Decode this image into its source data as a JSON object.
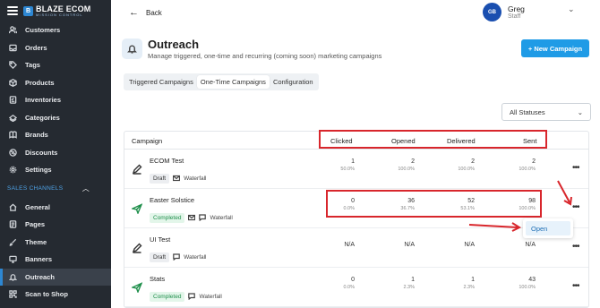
{
  "brand": {
    "name": "BLAZE ECOM",
    "tagline": "MISSION CONTROL"
  },
  "sidebar": {
    "items": [
      {
        "label": "Customers",
        "icon": "users-icon"
      },
      {
        "label": "Orders",
        "icon": "inbox-icon"
      },
      {
        "label": "Tags",
        "icon": "tag-icon"
      },
      {
        "label": "Products",
        "icon": "box-icon"
      },
      {
        "label": "Inventories",
        "icon": "list-check-icon"
      },
      {
        "label": "Categories",
        "icon": "categories-icon"
      },
      {
        "label": "Brands",
        "icon": "book-icon"
      },
      {
        "label": "Discounts",
        "icon": "discount-icon"
      },
      {
        "label": "Settings",
        "icon": "gear-icon"
      }
    ],
    "section_label": "SALES CHANNELS",
    "channel_items": [
      {
        "label": "General",
        "icon": "home-icon"
      },
      {
        "label": "Pages",
        "icon": "pages-icon"
      },
      {
        "label": "Theme",
        "icon": "brush-icon"
      },
      {
        "label": "Banners",
        "icon": "monitor-icon"
      },
      {
        "label": "Outreach",
        "icon": "bell-icon",
        "active": true
      },
      {
        "label": "Scan to Shop",
        "icon": "qr-icon"
      }
    ]
  },
  "header": {
    "back_label": "Back",
    "user": {
      "initials": "GB",
      "name": "Greg",
      "role": "Staff"
    }
  },
  "page": {
    "title": "Outreach",
    "subtitle": "Manage triggered, one-time and recurring (coming soon) marketing campaigns",
    "new_button": "+ New Campaign"
  },
  "tabs": [
    {
      "label": "Triggered Campaigns",
      "active": false
    },
    {
      "label": "One-Time Campaigns",
      "active": true
    },
    {
      "label": "Configuration",
      "active": false
    }
  ],
  "filter": {
    "selected": "All Statuses"
  },
  "table": {
    "headers": {
      "campaign": "Campaign",
      "clicked": "Clicked",
      "opened": "Opened",
      "delivered": "Delivered",
      "sent": "Sent"
    },
    "rows": [
      {
        "name": "ECOM Test",
        "status": "Draft",
        "status_type": "draft",
        "icon": "pencil-icon",
        "meta": "Waterfall",
        "clicked": {
          "v": "1",
          "p": "50.0%"
        },
        "opened": {
          "v": "2",
          "p": "100.0%"
        },
        "delivered": {
          "v": "2",
          "p": "100.0%"
        },
        "sent": {
          "v": "2",
          "p": "100.0%"
        }
      },
      {
        "name": "Easter Solstice",
        "status": "Completed",
        "status_type": "completed",
        "icon": "send-icon",
        "meta": "Waterfall",
        "clicked": {
          "v": "0",
          "p": "0.0%"
        },
        "opened": {
          "v": "36",
          "p": "36.7%"
        },
        "delivered": {
          "v": "52",
          "p": "53.1%"
        },
        "sent": {
          "v": "98",
          "p": "100.0%"
        }
      },
      {
        "name": "UI Test",
        "status": "Draft",
        "status_type": "draft",
        "icon": "pencil-icon",
        "meta": "Waterfall",
        "clicked": {
          "na": "N/A"
        },
        "opened": {
          "na": "N/A"
        },
        "delivered": {
          "na": "N/A"
        },
        "sent": {
          "na": "N/A"
        }
      },
      {
        "name": "Stats",
        "status": "Completed",
        "status_type": "completed",
        "icon": "send-icon",
        "meta": "Waterfall",
        "clicked": {
          "v": "0",
          "p": "0.0%"
        },
        "opened": {
          "v": "1",
          "p": "2.3%"
        },
        "delivered": {
          "v": "1",
          "p": "2.3%"
        },
        "sent": {
          "v": "43",
          "p": "100.0%"
        }
      }
    ]
  },
  "row_menu": {
    "items": [
      "Open"
    ]
  },
  "colors": {
    "accent": "#1f9be6",
    "sidebar_bg": "#252a31",
    "annotation_red": "#d8262c",
    "completed_green": "#1f8f4b"
  }
}
